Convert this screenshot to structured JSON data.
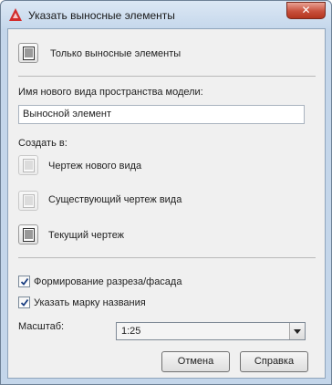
{
  "window": {
    "title": "Указать выносные элементы",
    "close_glyph": "✕",
    "accent": "#c8503c"
  },
  "top_option": {
    "label": "Только выносные элементы",
    "icon": "document-list-icon"
  },
  "view_name": {
    "label": "Имя нового вида пространства модели:",
    "value": "Выносной элемент"
  },
  "create_in": {
    "label": "Создать в:",
    "options": [
      {
        "label": "Чертеж нового вида",
        "enabled": false,
        "icon": "document-list-icon"
      },
      {
        "label": "Существующий чертеж вида",
        "enabled": false,
        "icon": "document-list-icon"
      },
      {
        "label": "Текущий чертеж",
        "enabled": true,
        "icon": "document-list-icon"
      }
    ]
  },
  "checkboxes": [
    {
      "label": "Формирование разреза/фасада",
      "checked": true
    },
    {
      "label": "Указать марку названия",
      "checked": true
    }
  ],
  "scale": {
    "label": "Масштаб:",
    "value": "1:25"
  },
  "buttons": {
    "cancel": "Отмена",
    "help": "Справка"
  }
}
